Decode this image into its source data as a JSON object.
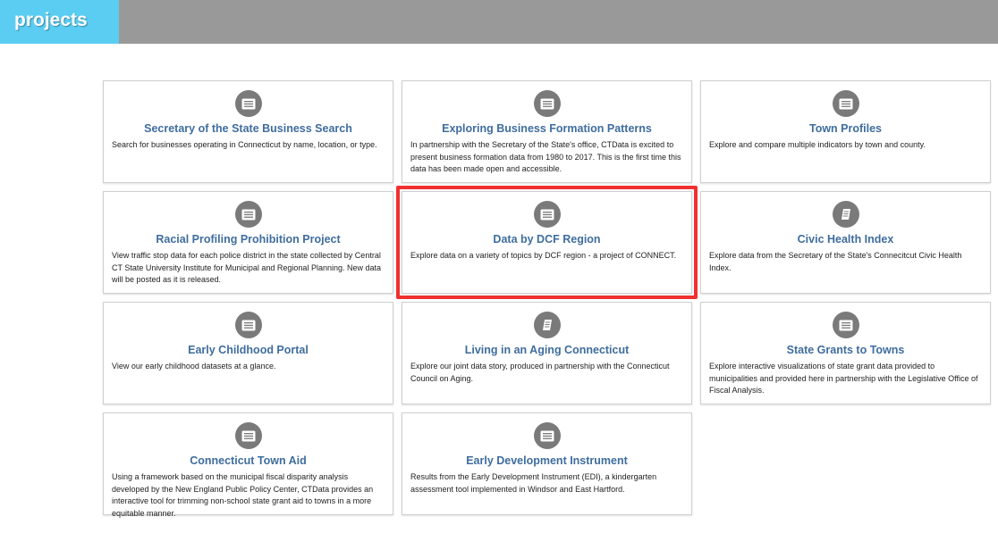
{
  "header": {
    "brand": "projects",
    "brand_color": "#5bcdf2",
    "bar_color": "#999999"
  },
  "accent_color": "#3f6d9e",
  "highlight_color": "#f03030",
  "cards": [
    {
      "title": "Secretary of the State Business Search",
      "description": "Search for businesses operating in Connecticut by name, location, or type.",
      "icon": "document-icon"
    },
    {
      "title": "Exploring Business Formation Patterns",
      "description": "In partnership with the Secretary of the State's office, CTData is excited to present business formation data from 1980 to 2017. This is the first time this data has been made open and accessible.",
      "icon": "document-icon"
    },
    {
      "title": "Town Profiles",
      "description": "Explore and compare multiple indicators by town and county.",
      "icon": "document-icon"
    },
    {
      "title": "Racial Profiling Prohibition Project",
      "description": "View traffic stop data for each police district in the state collected by Central CT State University Institute for Municipal and Regional Planning. New data will be posted as it is released.",
      "icon": "document-icon"
    },
    {
      "title": "Data by DCF Region",
      "description": "Explore data on a variety of topics by DCF region - a project of CONNECT.",
      "icon": "document-icon",
      "highlighted": true
    },
    {
      "title": "Civic Health Index",
      "description": "Explore data from the Secretary of the State's Connecitcut Civic Health Index.",
      "icon": "book-icon"
    },
    {
      "title": "Early Childhood Portal",
      "description": "View our early childhood datasets at a glance.",
      "icon": "document-icon"
    },
    {
      "title": "Living in an Aging Connecticut",
      "description": "Explore our joint data story, produced in partnership with the Connecticut Council on Aging.",
      "icon": "book-icon"
    },
    {
      "title": "State Grants to Towns",
      "description": "Explore interactive visualizations of state grant data provided to municipalities and provided here in partnership with the Legislative Office of Fiscal Analysis.",
      "icon": "document-icon"
    },
    {
      "title": "Connecticut Town Aid",
      "description": "Using a framework based on the municipal fiscal disparity analysis developed by the New England Public Policy Center, CTData provides an interactive tool for trimming non-school state grant aid to towns in a more equitable manner.",
      "icon": "document-icon"
    },
    {
      "title": "Early Development Instrument",
      "description": "Results from the Early Development Instrument (EDI), a kindergarten assessment tool implemented in Windsor and East Hartford.",
      "icon": "document-icon"
    }
  ]
}
